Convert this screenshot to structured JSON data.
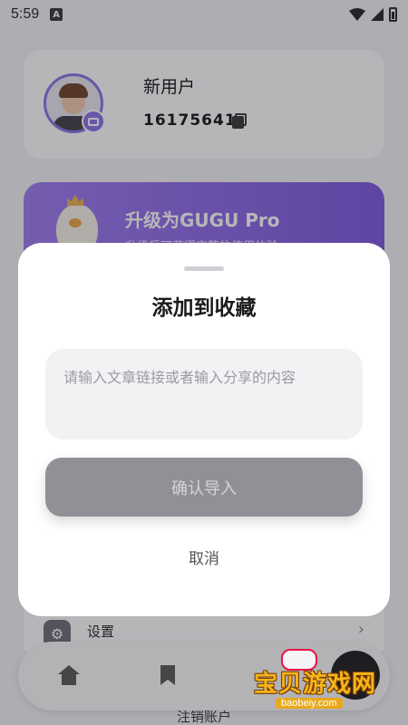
{
  "status_bar": {
    "time": "5:59",
    "notification_icon": "A"
  },
  "profile": {
    "username": "新用户",
    "user_id": "16175641"
  },
  "pro_banner": {
    "title": "升级为GUGU Pro",
    "subtitle": "升级后可获得完整的使用体验"
  },
  "settings": {
    "label": "设置",
    "chevron": "›"
  },
  "logout": {
    "label": "注销账户"
  },
  "dialog": {
    "title": "添加到收藏",
    "input_placeholder": "请输入文章链接或者输入分享的内容",
    "confirm_label": "确认导入",
    "cancel_label": "取消"
  },
  "watermark": {
    "text": "宝贝游戏网",
    "url": "baobeiy.com"
  }
}
